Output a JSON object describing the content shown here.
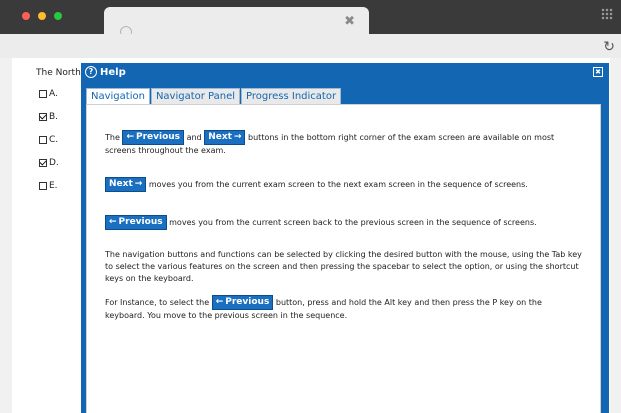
{
  "browser": {
    "tab_close": "✖",
    "reload": "↻"
  },
  "exam": {
    "question_fragment": "The North",
    "options": [
      {
        "label": "A.",
        "checked": false
      },
      {
        "label": "B.",
        "checked": true
      },
      {
        "label": "C.",
        "checked": false
      },
      {
        "label": "D.",
        "checked": true
      },
      {
        "label": "E.",
        "checked": false
      }
    ]
  },
  "help": {
    "title": "Help",
    "close": "✖",
    "tabs": [
      "Navigation",
      "Navigator Panel",
      "Progress Indicator"
    ],
    "active_tab": "Navigation",
    "buttons": {
      "previous": "Previous",
      "next": "Next"
    },
    "p1_pre": "The",
    "p1_mid": "and",
    "p1_post": "buttons in the bottom right corner of the exam screen are available on most screens throughout the exam.",
    "p2_post": "moves you from the current exam screen to the next exam screen in the sequence of screens.",
    "p3_post": "moves you from the current screen back to the previous screen in the sequence of screens.",
    "p4": "The navigation buttons and functions can be selected by clicking the desired button with the mouse, using the Tab key to select the various features on the screen and then pressing the spacebar to select the option, or using the shortcut keys on the keyboard.",
    "p5_pre": "For Instance, to select the",
    "p5_post": "button, press and hold the Alt key and then press the P key on the keyboard. You move to the previous screen in the sequence."
  }
}
